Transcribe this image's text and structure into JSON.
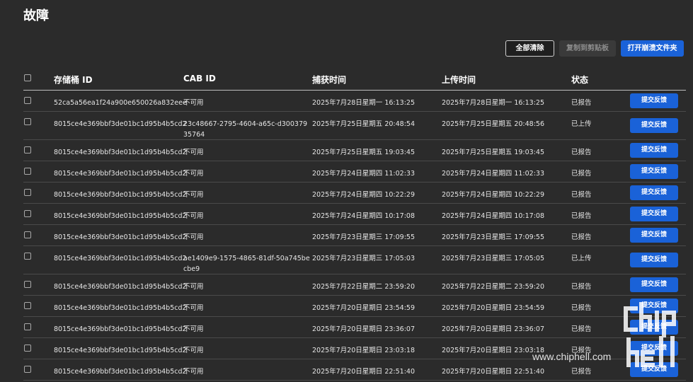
{
  "page": {
    "title": "故障"
  },
  "toolbar": {
    "clear_label": "全部清除",
    "copy_label": "复制到剪贴板",
    "open_label": "打开崩溃文件夹"
  },
  "table": {
    "headers": {
      "bucket_id": "存储桶 ID",
      "cab_id": "CAB ID",
      "capture_time": "捕获时间",
      "upload_time": "上传时间",
      "status": "状态"
    },
    "feedback_label": "提交反馈",
    "rows": [
      {
        "bucket_id": "52ca5a56ea1f24a900e650026a832eee",
        "cab_id": "不可用",
        "capture_time": "2025年7月28日星期一 16:13:25",
        "upload_time": "2025年7月28日星期一 16:13:25",
        "status": "已报告"
      },
      {
        "bucket_id": "8015ce4e369bbf3de01bc1d95b4b5cd2",
        "cab_id": "23c48667-2795-4604-a65c-d30037935764",
        "capture_time": "2025年7月25日星期五 20:48:54",
        "upload_time": "2025年7月25日星期五 20:48:56",
        "status": "已上传"
      },
      {
        "bucket_id": "8015ce4e369bbf3de01bc1d95b4b5cd2",
        "cab_id": "不可用",
        "capture_time": "2025年7月25日星期五 19:03:45",
        "upload_time": "2025年7月25日星期五 19:03:45",
        "status": "已报告"
      },
      {
        "bucket_id": "8015ce4e369bbf3de01bc1d95b4b5cd2",
        "cab_id": "不可用",
        "capture_time": "2025年7月24日星期四 11:02:33",
        "upload_time": "2025年7月24日星期四 11:02:33",
        "status": "已报告"
      },
      {
        "bucket_id": "8015ce4e369bbf3de01bc1d95b4b5cd2",
        "cab_id": "不可用",
        "capture_time": "2025年7月24日星期四 10:22:29",
        "upload_time": "2025年7月24日星期四 10:22:29",
        "status": "已报告"
      },
      {
        "bucket_id": "8015ce4e369bbf3de01bc1d95b4b5cd2",
        "cab_id": "不可用",
        "capture_time": "2025年7月24日星期四 10:17:08",
        "upload_time": "2025年7月24日星期四 10:17:08",
        "status": "已报告"
      },
      {
        "bucket_id": "8015ce4e369bbf3de01bc1d95b4b5cd2",
        "cab_id": "不可用",
        "capture_time": "2025年7月23日星期三 17:09:55",
        "upload_time": "2025年7月23日星期三 17:09:55",
        "status": "已报告"
      },
      {
        "bucket_id": "8015ce4e369bbf3de01bc1d95b4b5cd2",
        "cab_id": "ae1409e9-1575-4865-81df-50a745becbe9",
        "capture_time": "2025年7月23日星期三 17:05:03",
        "upload_time": "2025年7月23日星期三 17:05:05",
        "status": "已上传"
      },
      {
        "bucket_id": "8015ce4e369bbf3de01bc1d95b4b5cd2",
        "cab_id": "不可用",
        "capture_time": "2025年7月22日星期二 23:59:20",
        "upload_time": "2025年7月22日星期二 23:59:20",
        "status": "已报告"
      },
      {
        "bucket_id": "8015ce4e369bbf3de01bc1d95b4b5cd2",
        "cab_id": "不可用",
        "capture_time": "2025年7月20日星期日 23:54:59",
        "upload_time": "2025年7月20日星期日 23:54:59",
        "status": "已报告"
      },
      {
        "bucket_id": "8015ce4e369bbf3de01bc1d95b4b5cd2",
        "cab_id": "不可用",
        "capture_time": "2025年7月20日星期日 23:36:07",
        "upload_time": "2025年7月20日星期日 23:36:07",
        "status": "已报告"
      },
      {
        "bucket_id": "8015ce4e369bbf3de01bc1d95b4b5cd2",
        "cab_id": "不可用",
        "capture_time": "2025年7月20日星期日 23:03:18",
        "upload_time": "2025年7月20日星期日 23:03:18",
        "status": "已报告"
      },
      {
        "bucket_id": "8015ce4e369bbf3de01bc1d95b4b5cd2",
        "cab_id": "不可用",
        "capture_time": "2025年7月20日星期日 22:51:40",
        "upload_time": "2025年7月20日星期日 22:51:40",
        "status": "已报告"
      }
    ]
  },
  "watermark": {
    "text": "www.chiphell.com",
    "logo_text": "chip hell"
  },
  "colors": {
    "background": "#2b2b2b",
    "accent": "#1a62d8"
  }
}
